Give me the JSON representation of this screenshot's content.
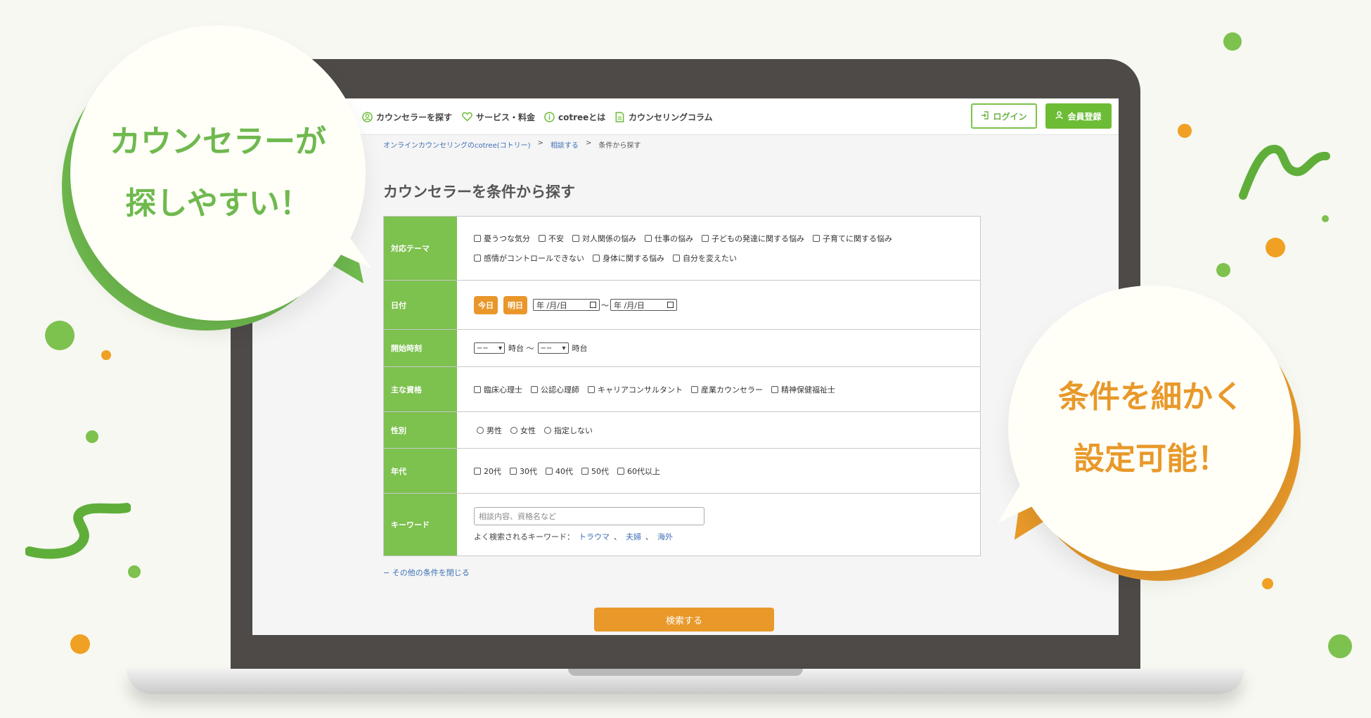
{
  "colors": {
    "green": "#6fb94e",
    "orange": "#e8992a",
    "link": "#3d6fb6"
  },
  "bubbles": {
    "left": {
      "line1": "カウンセラーが",
      "line2": "探しやすい！"
    },
    "right": {
      "line1": "条件を細かく",
      "line2": "設定可能！"
    }
  },
  "nav": {
    "find": "カウンセラーを探す",
    "service": "サービス・料金",
    "about": "cotreeとは",
    "column": "カウンセリングコラム",
    "login": "ログイン",
    "register": "会員登録",
    "icons": [
      "person-search-icon",
      "heart-icon",
      "info-icon",
      "document-icon",
      "login-icon",
      "user-icon"
    ]
  },
  "breadcrumb": {
    "home": "オンラインカウンセリングのcotree(コトリー)",
    "sep": ">",
    "consult": "相談する",
    "current": "条件から探す"
  },
  "page_title": "カウンセラーを条件から探す",
  "form": {
    "theme": {
      "label": "対応テーマ",
      "options": [
        "憂うつな気分",
        "不安",
        "対人関係の悩み",
        "仕事の悩み",
        "子どもの発達に関する悩み",
        "子育てに関する悩み",
        "感情がコントロールできない",
        "身体に関する悩み",
        "自分を変えたい"
      ]
    },
    "date": {
      "label": "日付",
      "today": "今日",
      "tomorrow": "明日",
      "from_placeholder": "年 /月/日",
      "to_placeholder": "年 /月/日",
      "tilde": "〜"
    },
    "start_time": {
      "label": "開始時刻",
      "select_from": "−−",
      "select_to": "−−",
      "suffix_from": "時台 〜",
      "suffix_to": "時台"
    },
    "qualification": {
      "label": "主な資格",
      "options": [
        "臨床心理士",
        "公認心理師",
        "キャリアコンサルタント",
        "産業カウンセラー",
        "精神保健福祉士"
      ]
    },
    "gender": {
      "label": "性別",
      "options": [
        "男性",
        "女性",
        "指定しない"
      ]
    },
    "age": {
      "label": "年代",
      "options": [
        "20代",
        "30代",
        "40代",
        "50代",
        "60代以上"
      ]
    },
    "keyword": {
      "label": "キーワード",
      "placeholder": "相談内容、資格名など",
      "hint_prefix": "よく検索されるキーワード：",
      "suggestions": [
        "トラウマ",
        "夫婦",
        "海外"
      ],
      "sep": "、"
    }
  },
  "close_link": "− その他の条件を閉じる",
  "search_button": "検索する"
}
